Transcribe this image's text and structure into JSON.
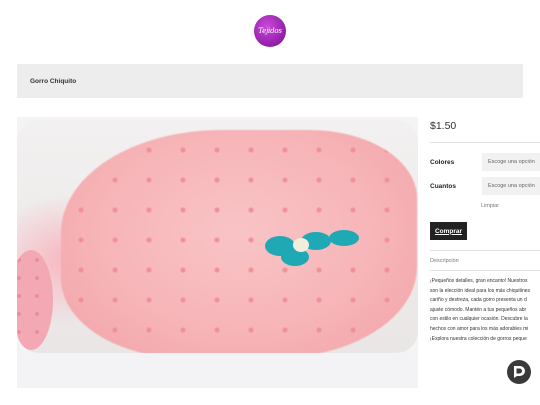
{
  "brand": {
    "logo_text": "Tejidos",
    "logo_color": "#9a23b0"
  },
  "product": {
    "title": "Gorro Chiquito",
    "price": "$1.50"
  },
  "options": [
    {
      "label": "Colores",
      "placeholder": "Escoge una opción"
    },
    {
      "label": "Cuantos",
      "placeholder": "Escoge una opción"
    }
  ],
  "clear_label": "Limpiar",
  "buy_label": "Comprar",
  "description": {
    "heading": "Descripción",
    "lines": [
      "¡Pequeños detalles, gran encanto! Nuestros",
      "son la elección ideal para los más chiquitines",
      "cariño y destreza, cada gorro presenta un d",
      "ajuste cómodo. Mantén a tus pequeños abr",
      "con estilo en cualquier ocasión. Descubre la",
      "hechos con amor para los más adorables mi",
      "¡Explora nuestra colección de gorros peque"
    ]
  },
  "chat": {
    "icon": "chat-bubble-icon",
    "label": "D"
  }
}
